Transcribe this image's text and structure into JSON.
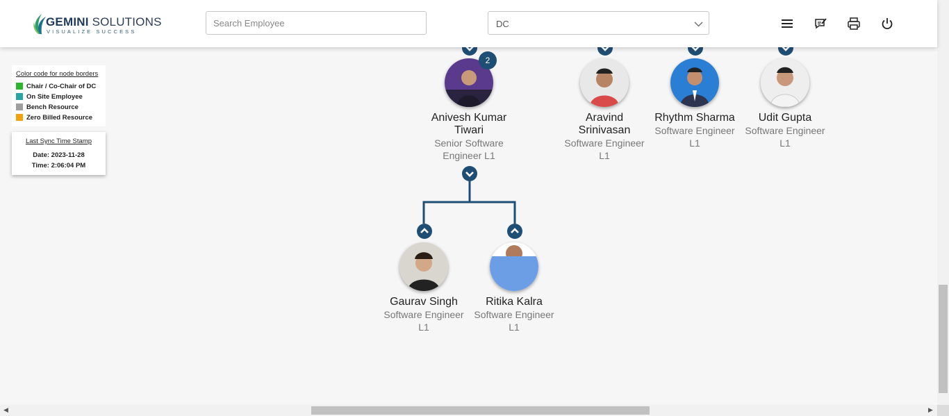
{
  "brand": {
    "name_bold": "GEMINI",
    "name_rest": " SOLUTIONS",
    "tagline": "VISUALIZE SUCCESS"
  },
  "header": {
    "search_placeholder": "Search Employee",
    "search_value": "",
    "dc_select_value": "DC",
    "icons": [
      "menu-icon",
      "feedback-icon",
      "print-icon",
      "power-icon"
    ]
  },
  "legend": {
    "title": "Color code for node borders",
    "items": [
      {
        "label": "Chair / Co-Chair of DC",
        "color": "#2db52d"
      },
      {
        "label": "On Site Employee",
        "color": "#2aa3a3"
      },
      {
        "label": "Bench Resource",
        "color": "#9e9e9e"
      },
      {
        "label": "Zero Billed Resource",
        "color": "#f2a20c"
      }
    ]
  },
  "sync": {
    "title": "Last Sync Time Stamp",
    "date": "Date: 2023-11-28",
    "time": "Time: 2:06:04 PM"
  },
  "org_nodes": [
    {
      "name": "Anivesh Kumar Tiwari",
      "name_line1": "Anivesh Kumar",
      "name_line2": "Tiwari",
      "role_line1": "Senior Software",
      "role_line2": "Engineer L1",
      "badge": "2"
    },
    {
      "name": "Aravind Srinivasan",
      "name_line1": "Aravind",
      "name_line2": "Srinivasan",
      "role_line1": "Software Engineer",
      "role_line2": "L1"
    },
    {
      "name": "Rhythm Sharma",
      "role_line1": "Software Engineer",
      "role_line2": "L1"
    },
    {
      "name": "Udit Gupta",
      "role_line1": "Software Engineer",
      "role_line2": "L1"
    },
    {
      "name": "Gaurav Singh",
      "role_line1": "Software Engineer",
      "role_line2": "L1"
    },
    {
      "name": "Ritika Kalra",
      "role_line1": "Software Engineer",
      "role_line2": "L1"
    }
  ],
  "colors": {
    "toggle": "#1f4e75",
    "connector": "#1f4e75"
  }
}
